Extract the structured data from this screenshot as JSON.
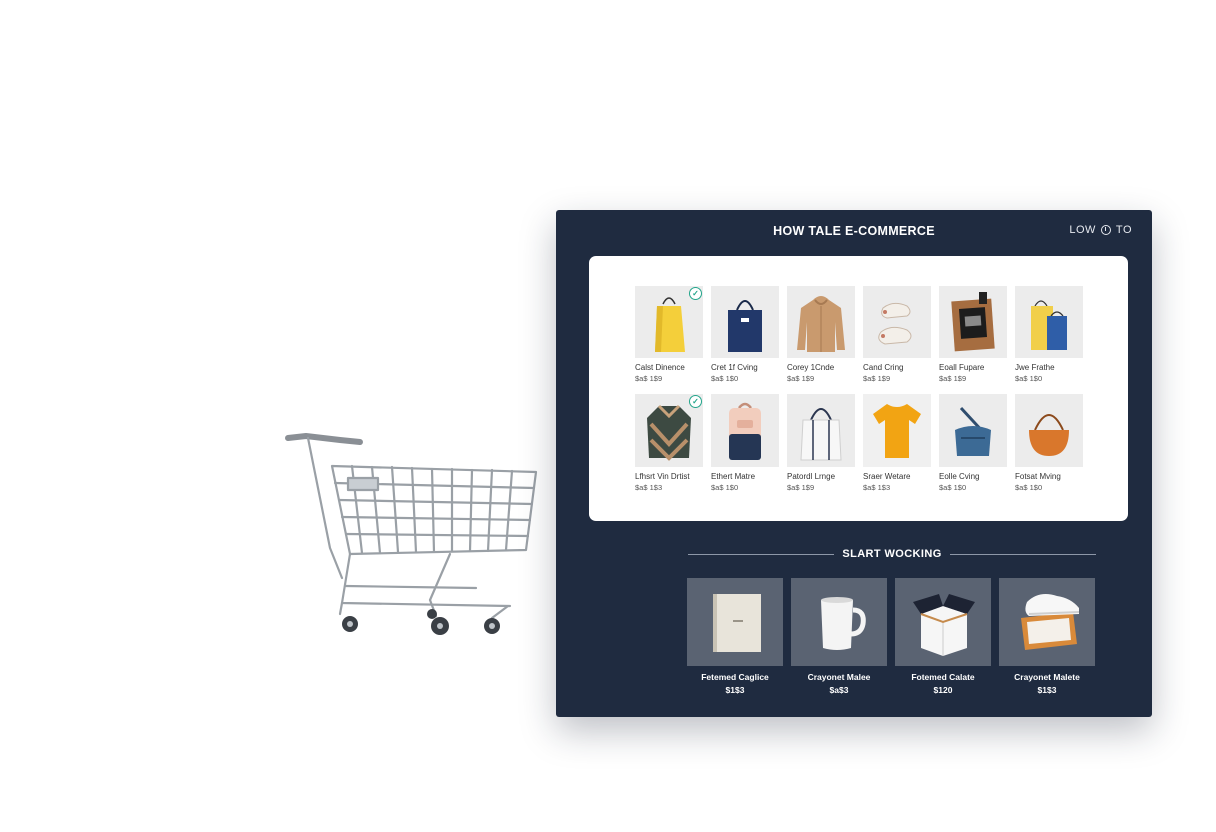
{
  "header": {
    "title": "HOW TALE E-COMMERCE",
    "top_right_left": "LOW",
    "top_right_right": "TO"
  },
  "products": [
    {
      "name": "Calst Dinence",
      "price": "$a$ 1$9",
      "image": "yellow-shopping-bag",
      "selected": true
    },
    {
      "name": "Cret 1f Cving",
      "price": "$a$ 1$0",
      "image": "navy-tote-bag",
      "selected": false
    },
    {
      "name": "Corey 1Cnde",
      "price": "$a$ 1$9",
      "image": "beige-hoodie",
      "selected": false
    },
    {
      "name": "Cand Cring",
      "price": "$a$ 1$9",
      "image": "sneakers-pair",
      "selected": false
    },
    {
      "name": "Eoall Fupare",
      "price": "$a$ 1$9",
      "image": "kraft-gift-box",
      "selected": false
    },
    {
      "name": "Jwe Frathe",
      "price": "$a$ 1$0",
      "image": "yellow-blue-bags",
      "selected": false
    },
    {
      "name": "Lfhsrt Vin Drtist",
      "price": "$a$ 1$3",
      "image": "patterned-sweater",
      "selected": true
    },
    {
      "name": "Ethert Matre",
      "price": "$a$ 1$0",
      "image": "two-tone-backpack",
      "selected": false
    },
    {
      "name": "Patordl Lrnge",
      "price": "$a$ 1$9",
      "image": "white-canvas-tote",
      "selected": false
    },
    {
      "name": "Sraer Wetare",
      "price": "$a$ 1$3",
      "image": "yellow-tshirt",
      "selected": false
    },
    {
      "name": "Eolle Cving",
      "price": "$a$ 1$0",
      "image": "denim-crossbody-bag",
      "selected": false
    },
    {
      "name": "Fotsat Mving",
      "price": "$a$ 1$0",
      "image": "orange-round-bag",
      "selected": false
    }
  ],
  "section": {
    "heading": "SLART WOCKING"
  },
  "featured": [
    {
      "name": "Fetemed Caglice",
      "price": "$1$3",
      "image": "book"
    },
    {
      "name": "Crayonet Malee",
      "price": "$a$3",
      "image": "white-mug"
    },
    {
      "name": "Fotemed Calate",
      "price": "$120",
      "image": "open-box"
    },
    {
      "name": "Crayonet Malete",
      "price": "$1$3",
      "image": "sneaker-box"
    }
  ],
  "colors": {
    "panel_bg": "#1f2b40",
    "card_bg": "#ffffff",
    "check_accent": "#23a58b",
    "feature_tile": "#5a6372"
  }
}
